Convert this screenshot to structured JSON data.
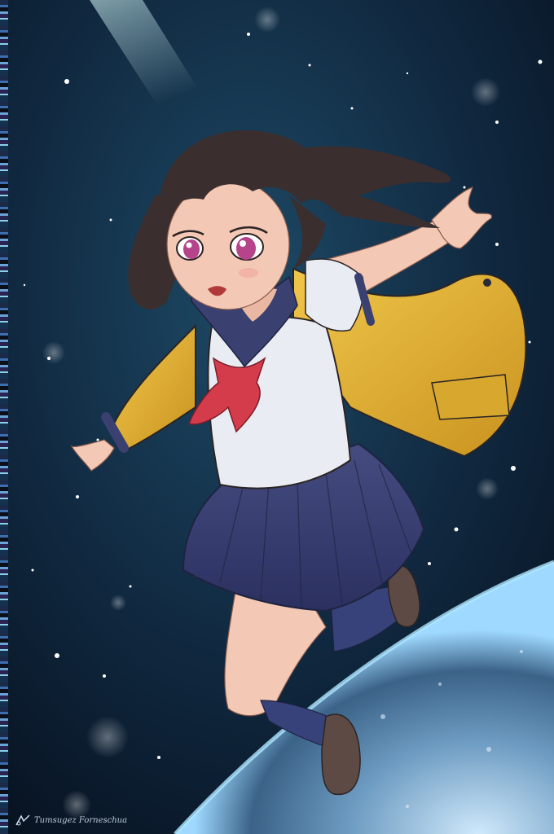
{
  "image": {
    "subject": "anime schoolgirl floating in space above Earth",
    "colors": {
      "space": "#0f2740",
      "space_deep": "#07111f",
      "planet_glow": "#8fd4ff",
      "jacket": "#e6b533",
      "skirt": "#3a4070",
      "scarf": "#d43c4c",
      "shirt": "#e9ecf3",
      "hair": "#3a2e2e",
      "skin": "#f3c8b4",
      "eyes": "#b5448a"
    }
  },
  "watermark": {
    "text": "Tumsugez Forneschua"
  }
}
